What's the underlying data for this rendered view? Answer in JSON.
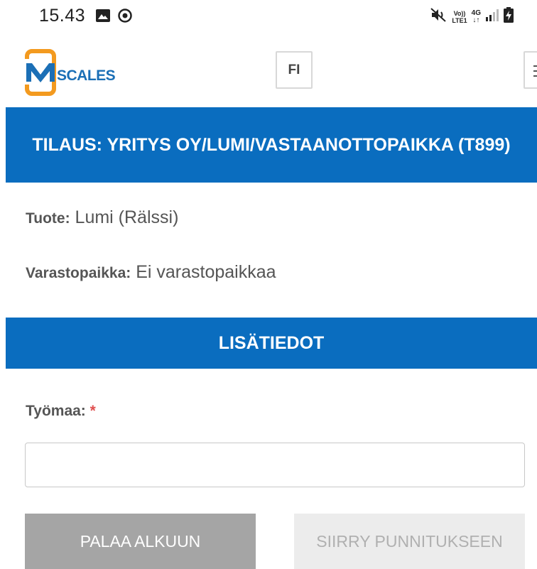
{
  "status_bar": {
    "time": "15.43",
    "volte_top": "Vo))",
    "volte_bottom": "LTE1",
    "network": "4G",
    "icons": [
      "gallery-icon",
      "sync-icon",
      "mute-icon",
      "signal-icon",
      "battery-charging-icon"
    ]
  },
  "header": {
    "logo_text": "SCALES",
    "language": "FI"
  },
  "order": {
    "title": "TILAUS: YRITYS OY/LUMI/VASTAANOTTOPAIKKA (T899)"
  },
  "details": {
    "product_label": "Tuote:",
    "product_value": "Lumi (Rälssi)",
    "storage_label": "Varastopaikka:",
    "storage_value": "Ei varastopaikkaa"
  },
  "extra": {
    "title": "LISÄTIEDOT",
    "site_label": "Työmaa:",
    "required_mark": "*",
    "site_value": "",
    "site_placeholder": ""
  },
  "buttons": {
    "back": "PALAA ALKUUN",
    "next": "SIIRRY PUNNITUKSEEN"
  },
  "colors": {
    "accent_blue": "#0a6dbf",
    "logo_orange": "#f39a1f",
    "required_red": "#e05050"
  }
}
